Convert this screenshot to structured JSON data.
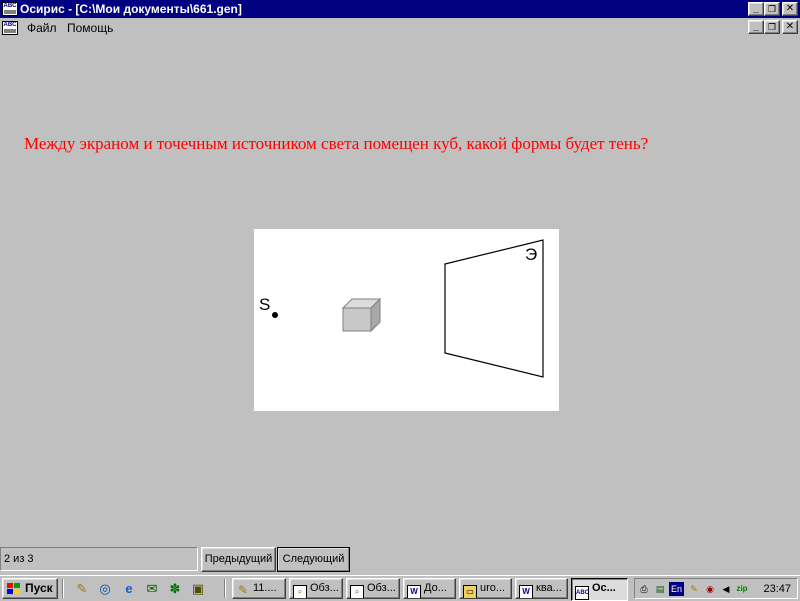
{
  "window": {
    "title": "Осирис - [C:\\Мои документы\\661.gen]",
    "icon_text": "ABC",
    "minimize_glyph": "_",
    "restore_glyph": "❐",
    "close_glyph": "✕"
  },
  "menu": {
    "items": [
      {
        "label": "Файл"
      },
      {
        "label": "Помощь"
      }
    ]
  },
  "content": {
    "question": "Между экраном и точечным источником света помещен куб, какой формы будет тень?",
    "figure": {
      "source_label": "S",
      "screen_label": "Э"
    }
  },
  "status": {
    "page_indicator": "2 из 3",
    "prev_label": "Предыдущий",
    "next_label": "Следующий"
  },
  "taskbar": {
    "start_label": "Пуск",
    "tasks": [
      {
        "label": "11....",
        "icon": "pencil-icon"
      },
      {
        "label": "Обз...",
        "icon": "magnifier-icon"
      },
      {
        "label": "Обз...",
        "icon": "magnifier-icon"
      },
      {
        "label": "До...",
        "icon": "word-icon"
      },
      {
        "label": "uro...",
        "icon": "folder-icon"
      },
      {
        "label": "ква...",
        "icon": "word-icon"
      },
      {
        "label": "Ос...",
        "icon": "abc-app-icon",
        "active": true
      }
    ],
    "tray": {
      "lang": "En",
      "clock": "23:47"
    }
  },
  "colors": {
    "titlebar": "#000080",
    "face": "#c0c0c0",
    "question_text": "#ff0000"
  }
}
